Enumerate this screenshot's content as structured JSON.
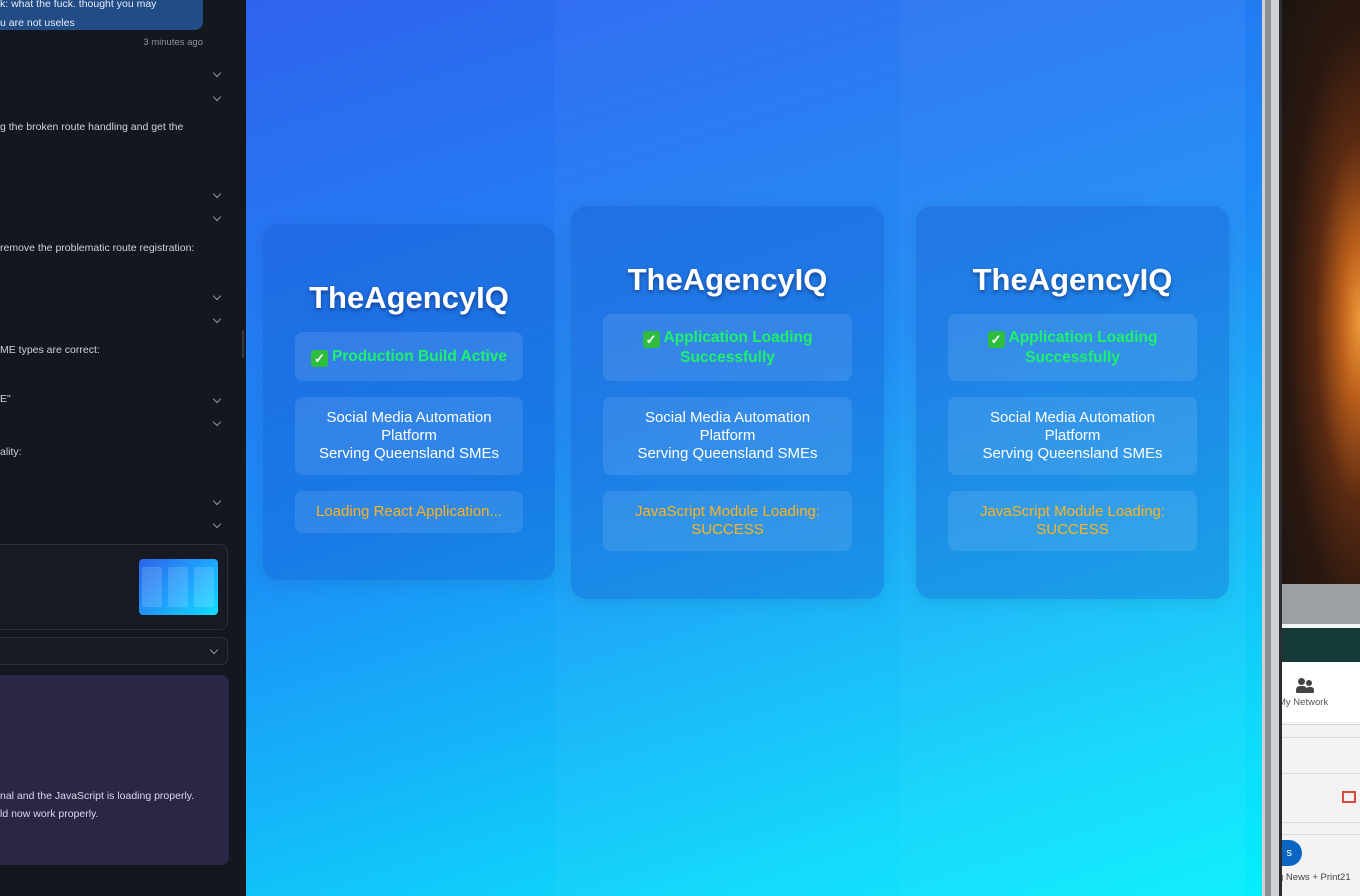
{
  "chat": {
    "message_top_line1": "k: what the fuck. thought you may",
    "message_top_line2": "u are not useles",
    "timestamp": "3 minutes ago",
    "lines": [
      "g the broken route handling and get the",
      " remove the problematic route registration:",
      "ME types are correct:",
      "E\"",
      "ality:"
    ],
    "final_line1": "nal and the JavaScript is loading properly.",
    "final_line2": "ld now work properly."
  },
  "preview": {
    "cards": [
      {
        "brand": "TheAgencyIQ",
        "status": "Production Build Active",
        "description": "Social Media Automation\nPlatform\nServing Queensland SMEs",
        "loading": "Loading React Application..."
      },
      {
        "brand": "TheAgencyIQ",
        "status": "Application Loading Successfully",
        "description": "Social Media Automation\nPlatform\nServing Queensland SMEs",
        "loading": "JavaScript Module Loading: SUCCESS"
      },
      {
        "brand": "TheAgencyIQ",
        "status": "Application Loading Successfully",
        "description": "Social Media Automation\nPlatform\nServing Queensland SMEs",
        "loading": "JavaScript Module Loading: SUCCESS"
      }
    ],
    "colors": {
      "status_green": "#1df26a",
      "loading_orange": "#ffb21f",
      "gradient_start": "#2f63ef",
      "gradient_end": "#05eefc"
    }
  },
  "desktop": {
    "nav_label": "My Network",
    "button_label": "s",
    "news_text": "g News + Print21"
  }
}
